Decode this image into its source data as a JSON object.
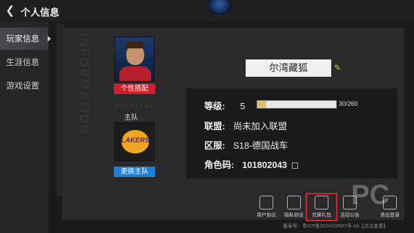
{
  "header": {
    "title": "个人信息",
    "back_icon": "chevron-left-icon"
  },
  "sidebar": {
    "items": [
      {
        "label": "玩家信息",
        "active": true
      },
      {
        "label": "生涯信息",
        "active": false
      },
      {
        "label": "游戏设置",
        "active": false
      }
    ]
  },
  "left_panel": {
    "watermark": "INFORMATION",
    "basketball_text": "BASKETBALL",
    "custom_button": "个性搭配",
    "team_label": "主队",
    "team_logo_text": "LAKERS",
    "change_team_button": "更换主队"
  },
  "player": {
    "name": "尔湾藏狐",
    "level_label": "等级:",
    "level": "5",
    "exp_text": "30/260",
    "exp_progress": 0.115,
    "league_label": "联盟:",
    "league_value": "尚未加入联盟",
    "server_label": "区服:",
    "server_value": "S18-德国战车",
    "role_label": "角色码:",
    "role_value": "101802043"
  },
  "toolbar": [
    {
      "label": "用户协议",
      "icon": "document-icon"
    },
    {
      "label": "隐私协议",
      "icon": "privacy-icon"
    },
    {
      "label": "兑换礼包",
      "icon": "gift-icon"
    },
    {
      "label": "活动公告",
      "icon": "bell-icon"
    },
    {
      "label": "退出登录",
      "icon": "logout-icon"
    }
  ],
  "footer": {
    "icp": "备案号：粤ICP备2024109927号-3A【点击查看】"
  },
  "colors": {
    "accent_red": "#d01f2d",
    "accent_blue": "#1e7fd6",
    "highlight": "#d8232a"
  }
}
